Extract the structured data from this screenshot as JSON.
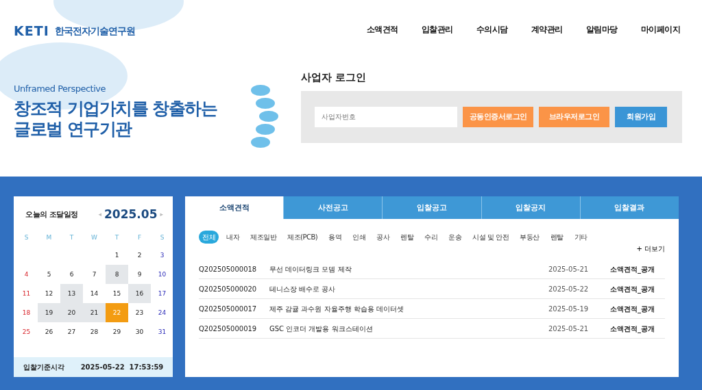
{
  "logo": {
    "mark": "KETI",
    "name": "한국전자기술연구원"
  },
  "nav": [
    "소액견적",
    "입찰관리",
    "수의시담",
    "계약관리",
    "알림마당",
    "마이페이지"
  ],
  "hero": {
    "subtitle": "Unframed Perspective",
    "title_lines": [
      "창조적 기업가치를 창출하는",
      "글로벌 연구기관"
    ]
  },
  "login": {
    "title": "사업자 로그인",
    "field": {
      "placeholder": "사업자번호"
    },
    "buttons": [
      {
        "label": "공동인증서로그인",
        "kind": "orange"
      },
      {
        "label": "브라우저로그인",
        "kind": "orange"
      },
      {
        "label": "회원가입",
        "kind": "blue"
      }
    ]
  },
  "calendar": {
    "title": "오늘의 조달일정",
    "month": "2025.05",
    "prev": "◂",
    "next": "▸",
    "weekdays": [
      "S",
      "M",
      "T",
      "W",
      "T",
      "F",
      "S"
    ],
    "weeks": [
      [
        {
          "day": "1",
          "has_event": false,
          "selected": false
        },
        {
          "day": "2",
          "has_event": false,
          "selected": false
        },
        {
          "day": "3",
          "has_event": false,
          "selected": false
        }
      ],
      [
        {
          "day": "4",
          "has_event": false,
          "selected": false
        },
        {
          "day": "5",
          "has_event": false,
          "selected": false
        },
        {
          "day": "6",
          "has_event": false,
          "selected": false
        },
        {
          "day": "7",
          "has_event": false,
          "selected": false
        },
        {
          "day": "8",
          "has_event": true,
          "selected": false
        },
        {
          "day": "9",
          "has_event": false,
          "selected": false
        },
        {
          "day": "10",
          "has_event": false,
          "selected": false
        }
      ],
      [
        {
          "day": "11",
          "has_event": false,
          "selected": false
        },
        {
          "day": "12",
          "has_event": false,
          "selected": false
        },
        {
          "day": "13",
          "has_event": true,
          "selected": false
        },
        {
          "day": "14",
          "has_event": false,
          "selected": false
        },
        {
          "day": "15",
          "has_event": false,
          "selected": false
        },
        {
          "day": "16",
          "has_event": true,
          "selected": false
        },
        {
          "day": "17",
          "has_event": false,
          "selected": false
        }
      ],
      [
        {
          "day": "18",
          "has_event": false,
          "selected": false
        },
        {
          "day": "19",
          "has_event": true,
          "selected": false
        },
        {
          "day": "20",
          "has_event": true,
          "selected": false
        },
        {
          "day": "21",
          "has_event": true,
          "selected": false
        },
        {
          "day": "22",
          "has_event": false,
          "selected": true
        },
        {
          "day": "23",
          "has_event": false,
          "selected": false
        },
        {
          "day": "24",
          "has_event": false,
          "selected": false
        }
      ],
      [
        {
          "day": "25",
          "has_event": false,
          "selected": false
        },
        {
          "day": "26",
          "has_event": false,
          "selected": false
        },
        {
          "day": "27",
          "has_event": false,
          "selected": false
        },
        {
          "day": "28",
          "has_event": false,
          "selected": false
        },
        {
          "day": "29",
          "has_event": false,
          "selected": false
        },
        {
          "day": "30",
          "has_event": false,
          "selected": false
        },
        {
          "day": "31",
          "has_event": false,
          "selected": false
        }
      ]
    ],
    "footer_label": "입찰기준시각",
    "footer_time": "2025-05-22  17:53:59"
  },
  "tabs": [
    {
      "label": "소액견적",
      "selected": true
    },
    {
      "label": "사전공고",
      "selected": false
    },
    {
      "label": "입찰공고",
      "selected": false
    },
    {
      "label": "입찰공지",
      "selected": false
    },
    {
      "label": "입찰결과",
      "selected": false
    }
  ],
  "categories": [
    {
      "label": "전체",
      "selected": true
    },
    {
      "label": "내자",
      "selected": false
    },
    {
      "label": "제조일반",
      "selected": false
    },
    {
      "label": "제조(PCB)",
      "selected": false
    },
    {
      "label": "용역",
      "selected": false
    },
    {
      "label": "인쇄",
      "selected": false
    },
    {
      "label": "공사",
      "selected": false
    },
    {
      "label": "렌탈",
      "selected": false
    },
    {
      "label": "수리",
      "selected": false
    },
    {
      "label": "운송",
      "selected": false
    },
    {
      "label": "시설 및 안전",
      "selected": false
    },
    {
      "label": "부동산",
      "selected": false
    },
    {
      "label": "렌탈",
      "selected": false
    },
    {
      "label": "기타",
      "selected": false
    }
  ],
  "more": "+ 더보기",
  "rows": [
    {
      "id": "Q202505000018",
      "title": "무선 데이터링크 모뎀 제작",
      "date": "2025-05-21",
      "type": "소액견적_공개"
    },
    {
      "id": "Q202505000020",
      "title": "테니스장 배수로 공사",
      "date": "2025-05-22",
      "type": "소액견적_공개"
    },
    {
      "id": "Q202505000017",
      "title": "제주 감귤 과수원 자율주행 학습용 데이터셋",
      "date": "2025-05-19",
      "type": "소액견적_공개"
    },
    {
      "id": "Q202505000019",
      "title": "GSC 인코더 개발용 워크스테이션",
      "date": "2025-05-21",
      "type": "소액견적_공개"
    }
  ]
}
